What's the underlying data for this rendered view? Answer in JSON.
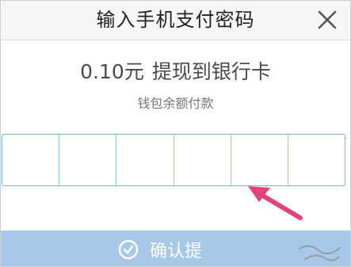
{
  "dialog": {
    "title": "输入手机支付密码",
    "close_icon": "close-icon"
  },
  "payment": {
    "amount": "0.10元",
    "action": "提现到银行卡",
    "source": "钱包余额付款"
  },
  "password": {
    "cells": 6,
    "border_color": "#79b6c9"
  },
  "confirm": {
    "label": "确认提",
    "icon": "shield-check-icon",
    "color": "#a7c8e9"
  },
  "annotation": {
    "arrow_color": "#e0457a"
  }
}
